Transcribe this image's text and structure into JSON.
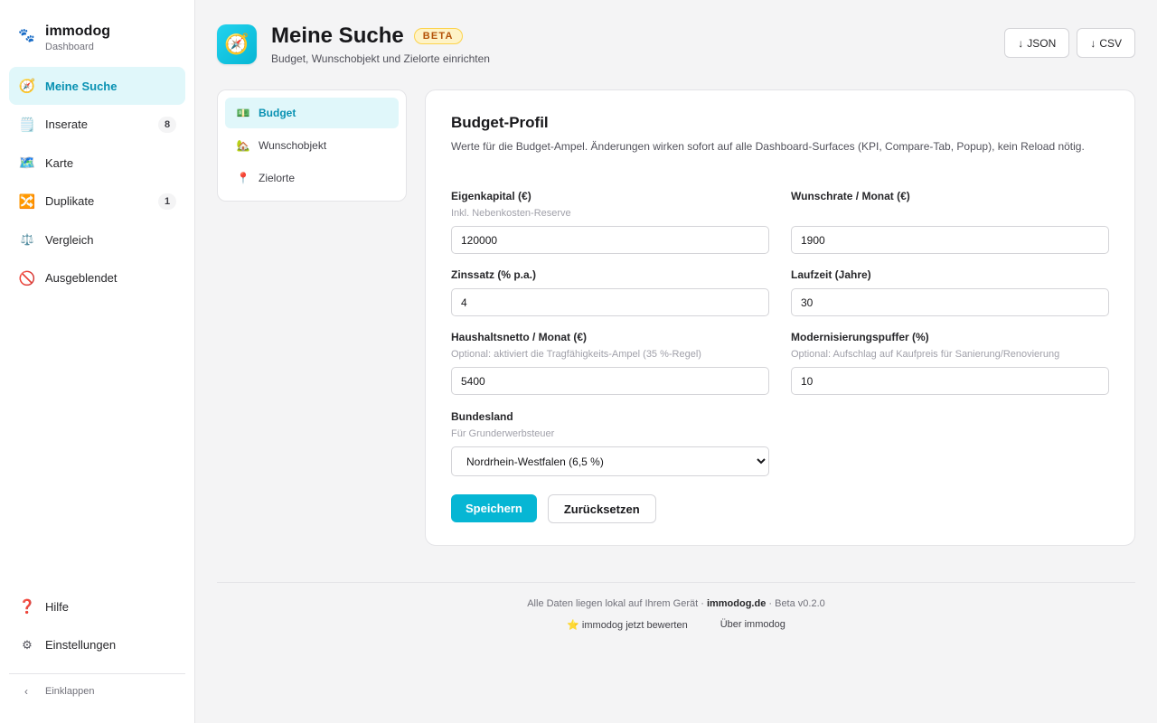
{
  "brand": {
    "title": "immodog",
    "subtitle": "Dashboard",
    "icon": "paw-icon"
  },
  "sidebar": {
    "items": [
      {
        "label": "Meine Suche",
        "icon": "compass-icon",
        "active": true
      },
      {
        "label": "Inserate",
        "icon": "notepad-icon",
        "badge": "8"
      },
      {
        "label": "Karte",
        "icon": "map-icon"
      },
      {
        "label": "Duplikate",
        "icon": "shuffle-icon",
        "badge": "1"
      },
      {
        "label": "Vergleich",
        "icon": "scales-icon"
      },
      {
        "label": "Ausgeblendet",
        "icon": "prohibited-icon"
      }
    ],
    "bottom": [
      {
        "label": "Hilfe",
        "icon": "question-icon"
      },
      {
        "label": "Einstellungen",
        "icon": "gear-icon"
      }
    ],
    "collapse_label": "Einklappen"
  },
  "header": {
    "title": "Meine Suche",
    "badge": "BETA",
    "subtitle": "Budget, Wunschobjekt und Zielorte einrichten",
    "buttons": {
      "json": "JSON",
      "csv": "CSV"
    }
  },
  "subnav": {
    "items": [
      {
        "label": "Budget",
        "icon": "money-icon",
        "active": true
      },
      {
        "label": "Wunschobjekt",
        "icon": "house-icon"
      },
      {
        "label": "Zielorte",
        "icon": "pin-icon"
      }
    ]
  },
  "form": {
    "title": "Budget-Profil",
    "description": "Werte für die Budget-Ampel. Änderungen wirken sofort auf alle Dashboard-Surfaces (KPI, Compare-Tab, Popup), kein Reload nötig.",
    "eigenkapital": {
      "label": "Eigenkapital (€)",
      "hint": "Inkl. Nebenkosten-Reserve",
      "value": "120000"
    },
    "wunschrate": {
      "label": "Wunschrate / Monat (€)",
      "value": "1900"
    },
    "zinssatz": {
      "label": "Zinssatz (% p.a.)",
      "value": "4"
    },
    "laufzeit": {
      "label": "Laufzeit (Jahre)",
      "value": "30"
    },
    "haushaltsnetto": {
      "label": "Haushaltsnetto / Monat (€)",
      "hint": "Optional: aktiviert die Tragfähigkeits-Ampel (35 %-Regel)",
      "value": "5400"
    },
    "modernisierung": {
      "label": "Modernisierungspuffer (%)",
      "hint": "Optional: Aufschlag auf Kaufpreis für Sanierung/Renovierung",
      "value": "10"
    },
    "bundesland": {
      "label": "Bundesland",
      "hint": "Für Grunderwerbsteuer",
      "selected": "Nordrhein-Westfalen (6,5 %)"
    },
    "save_label": "Speichern",
    "reset_label": "Zurücksetzen"
  },
  "footer": {
    "text_before": "Alle Daten liegen lokal auf Ihrem Gerät · ",
    "site": "immodog.de",
    "text_after": " · Beta v0.2.0",
    "rate_link": "immodog jetzt bewerten",
    "about_link": "Über immodog"
  },
  "colors": {
    "accent": "#06b6d4",
    "accent_bg": "#e0f7fa",
    "beta": "#b45309"
  }
}
